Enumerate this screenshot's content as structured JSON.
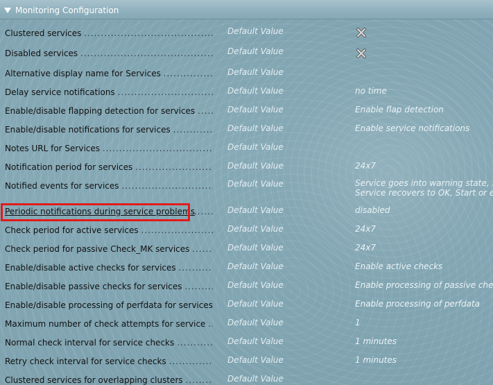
{
  "header": {
    "title": "Monitoring Configuration",
    "collapse_icon": "triangle-down-icon"
  },
  "default_label": "Default Value",
  "rows": [
    {
      "label": "Clustered services",
      "value": "",
      "icon": "x-icon"
    },
    {
      "label": "Disabled services",
      "value": "",
      "icon": "x-icon"
    },
    {
      "label": "Alternative display name for Services",
      "value": ""
    },
    {
      "label": "Delay service notifications",
      "value": "no time"
    },
    {
      "label": "Enable/disable flapping detection for services",
      "value": "Enable flap detection"
    },
    {
      "label": "Enable/disable notifications for services",
      "value": "Enable service notifications"
    },
    {
      "label": "Notes URL for Services",
      "value": ""
    },
    {
      "label": "Notification period for services",
      "value": "24x7"
    },
    {
      "label": "Notified events for services",
      "value": "Service goes into warning state, Serv",
      "value2": "Service recovers to OK, Start or end c"
    },
    {
      "label": "Periodic notifications during service problems",
      "value": "disabled",
      "highlighted": true
    },
    {
      "label": "Check period for active services",
      "value": "24x7"
    },
    {
      "label": "Check period for passive Check_MK services",
      "value": "24x7"
    },
    {
      "label": "Enable/disable active checks for services",
      "value": "Enable active checks"
    },
    {
      "label": "Enable/disable passive checks for services",
      "value": "Enable processing of passive check r"
    },
    {
      "label": "Enable/disable processing of perfdata for services",
      "value": "Enable processing of perfdata"
    },
    {
      "label": "Maximum number of check attempts for service",
      "value": "1"
    },
    {
      "label": "Normal check interval for service checks",
      "value": "1 minutes"
    },
    {
      "label": "Retry check interval for service checks",
      "value": "1 minutes"
    },
    {
      "label": "Clustered services for overlapping clusters",
      "value": ""
    }
  ],
  "colors": {
    "highlight_border": "#e21b1b",
    "background": "#7fa3b0",
    "header": "#8fb0bd"
  }
}
